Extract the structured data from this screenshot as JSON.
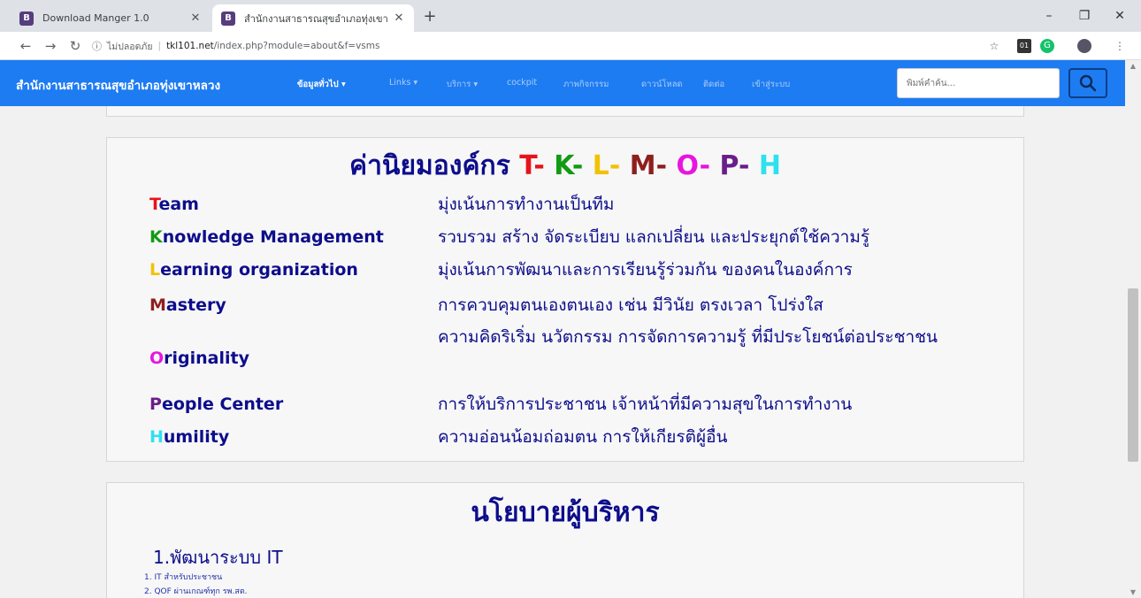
{
  "browser": {
    "tabs": [
      {
        "label": "Download Manger 1.0",
        "icon": "B"
      },
      {
        "label": "สำนักงานสาธารณสุขอำเภอทุ่งเขาหลวง",
        "icon": "B"
      }
    ],
    "url": {
      "security_label": "ไม่ปลอดภัย",
      "host": "tkl101.net",
      "path": "/index.php?module=about&f=vsms"
    },
    "ext_badge": "01"
  },
  "navbar": {
    "brand": "สำนักงานสาธารณสุขอำเภอทุ่งเขาหลวง",
    "links": [
      {
        "label": "ข้อมูลทั่วไป ▾",
        "active": true
      },
      {
        "label": "Links ▾",
        "active": false
      },
      {
        "label": "บริการ ▾",
        "active": false
      },
      {
        "label": "cockpit",
        "active": false
      },
      {
        "label": "ภาพกิจกรรม",
        "active": false
      },
      {
        "label": "ดาวน์โหลด",
        "active": false
      },
      {
        "label": "ติดต่อ",
        "active": false
      },
      {
        "label": "เข้าสู่ระบบ",
        "active": false
      }
    ],
    "search_placeholder": "พิมพ์คำค้น..."
  },
  "values": {
    "title_prefix": "ค่านิยมองค์กร",
    "letters": [
      {
        "text": "T-",
        "color": "#e8131a"
      },
      {
        "text": "K-",
        "color": "#129b12"
      },
      {
        "text": "L-",
        "color": "#f2c200"
      },
      {
        "text": "M-",
        "color": "#8e1f1f"
      },
      {
        "text": "O-",
        "color": "#e815e0"
      },
      {
        "text": "P-",
        "color": "#6b1d8a"
      },
      {
        "text": "H",
        "color": "#2ee0f0"
      }
    ],
    "items": [
      {
        "initial": "T",
        "rest": "eam",
        "color": "#e8131a",
        "desc": "มุ่งเน้นการทำงานเป็นทีม"
      },
      {
        "initial": "K",
        "rest": "nowledge Management",
        "color": "#129b12",
        "desc": "รวบรวม สร้าง จัดระเบียบ แลกเปลี่ยน และประยุกต์ใช้ความรู้"
      },
      {
        "initial": "L",
        "rest": "earning organization",
        "color": "#f2c200",
        "desc": "มุ่งเน้นการพัฒนาและการเรียนรู้ร่วมกัน ของคนในองค์การ"
      },
      {
        "initial": "M",
        "rest": "astery",
        "color": "#8e1f1f",
        "desc": "การควบคุมตนเองตนเอง เช่น มีวินัย ตรงเวลา โปร่งใส"
      },
      {
        "initial": "O",
        "rest": "riginality",
        "color": "#e815e0",
        "desc": "ความคิดริเริ่ม นวัตกรรม การจัดการความรู้ ที่มีประโยชน์ต่อประชาชน"
      },
      {
        "initial": "P",
        "rest": "eople Center",
        "color": "#6b1d8a",
        "desc": "การให้บริการประชาชน เจ้าหน้าที่มีความสุขในการทำงาน"
      },
      {
        "initial": "H",
        "rest": "umility",
        "color": "#2ee0f0",
        "desc": "ความอ่อนน้อมถ่อมตน การให้เกียรติผู้อื่น"
      }
    ]
  },
  "policy": {
    "title": "นโยบายผู้บริหาร",
    "subtitle": "1.พัฒนาระบบ IT",
    "items": [
      "1. IT สำหรับประชาชน",
      "2. QOF ผ่านเกณฑ์ทุก รพ.สต."
    ]
  }
}
